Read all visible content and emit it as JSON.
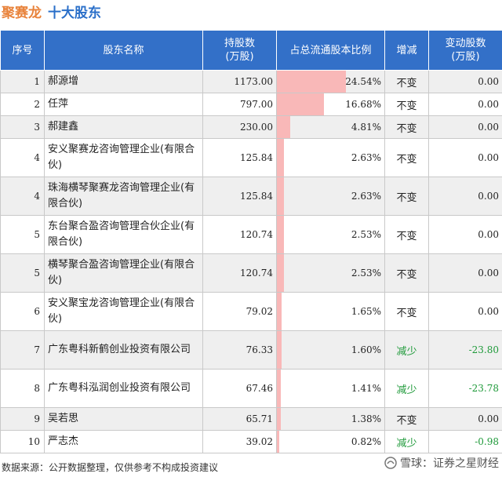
{
  "title": {
    "company": "聚赛龙",
    "subtitle": "十大股东"
  },
  "headers": {
    "rank": "序号",
    "name": "股东名称",
    "holding": "持股数\n(万股)",
    "pct": "占总流通股本比例",
    "change": "增减",
    "delta": "变动股数\n(万股)"
  },
  "rows": [
    {
      "rank": "1",
      "name": "郝源增",
      "holding": "1173.00",
      "pct": "24.54%",
      "pct_value": 24.54,
      "change": "不变",
      "delta": "0.00"
    },
    {
      "rank": "2",
      "name": "任萍",
      "holding": "797.00",
      "pct": "16.68%",
      "pct_value": 16.68,
      "change": "不变",
      "delta": "0.00"
    },
    {
      "rank": "3",
      "name": "郝建鑫",
      "holding": "230.00",
      "pct": "4.81%",
      "pct_value": 4.81,
      "change": "不变",
      "delta": "0.00"
    },
    {
      "rank": "4",
      "name": "安义聚赛龙咨询管理企业(有限合伙)",
      "holding": "125.84",
      "pct": "2.63%",
      "pct_value": 2.63,
      "change": "不变",
      "delta": "0.00"
    },
    {
      "rank": "4",
      "name": "珠海横琴聚赛龙咨询管理企业(有限合伙)",
      "holding": "125.84",
      "pct": "2.63%",
      "pct_value": 2.63,
      "change": "不变",
      "delta": "0.00"
    },
    {
      "rank": "5",
      "name": "东台聚合盈咨询管理合伙企业(有限合伙)",
      "holding": "120.74",
      "pct": "2.53%",
      "pct_value": 2.53,
      "change": "不变",
      "delta": "0.00"
    },
    {
      "rank": "5",
      "name": "横琴聚合盈咨询管理企业(有限合伙)",
      "holding": "120.74",
      "pct": "2.53%",
      "pct_value": 2.53,
      "change": "不变",
      "delta": "0.00"
    },
    {
      "rank": "6",
      "name": "安义聚宝龙咨询管理企业(有限合伙)",
      "holding": "79.02",
      "pct": "1.65%",
      "pct_value": 1.65,
      "change": "不变",
      "delta": "0.00"
    },
    {
      "rank": "7",
      "name": "广东粤科新鹤创业投资有限公司",
      "holding": "76.33",
      "pct": "1.60%",
      "pct_value": 1.6,
      "change": "减少",
      "delta": "-23.80"
    },
    {
      "rank": "8",
      "name": "广东粤科泓润创业投资有限公司",
      "holding": "67.46",
      "pct": "1.41%",
      "pct_value": 1.41,
      "change": "减少",
      "delta": "-23.78"
    },
    {
      "rank": "9",
      "name": "吴若思",
      "holding": "65.71",
      "pct": "1.38%",
      "pct_value": 1.38,
      "change": "不变",
      "delta": "0.00"
    },
    {
      "rank": "10",
      "name": "严志杰",
      "holding": "39.02",
      "pct": "0.82%",
      "pct_value": 0.82,
      "change": "减少",
      "delta": "-0.98"
    }
  ],
  "footer": "数据来源：公开数据整理，仅供参考不构成投资建议",
  "brand": "雪球：证券之星财经",
  "watermark": "证券之星",
  "colors": {
    "header_bg": "#3370c8",
    "bar": "#f9b8b8",
    "decrease": "#1f9a3a",
    "title_company": "#e8823a",
    "title_sub": "#2a6fc9"
  }
}
